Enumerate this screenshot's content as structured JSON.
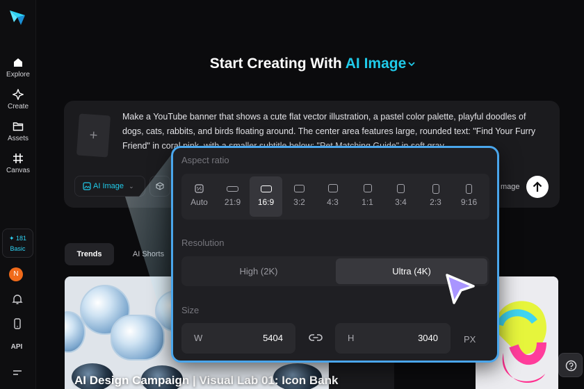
{
  "sidebar": {
    "logo": "app-logo",
    "items": [
      {
        "label": "Explore",
        "icon": "home-icon"
      },
      {
        "label": "Create",
        "icon": "sparkle-icon"
      },
      {
        "label": "Assets",
        "icon": "folder-icon"
      },
      {
        "label": "Canvas",
        "icon": "grid-icon"
      }
    ],
    "credits": "✦ 181",
    "plan": "Basic",
    "avatar_initial": "N",
    "api_label": "API"
  },
  "header": {
    "title_prefix": "Start Creating With",
    "title_accent": "AI Image",
    "accent_color": "#20cbea"
  },
  "prompt": {
    "add_glyph": "+",
    "text": "Make a YouTube banner that shows a cute flat vector illustration, a pastel color palette, playful doodles of dogs, cats, rabbits, and birds floating around. The center area features large, rounded text: \"Find Your Furry Friend\" in coral pink, with a smaller subtitle below: \"Pet Matching Guide\" in soft gray.",
    "mode_label": "AI Image",
    "trailing_label": "mage"
  },
  "tabs": [
    {
      "label": "Trends"
    },
    {
      "label": "AI Shorts"
    }
  ],
  "gallery": {
    "caption": "AI Design Campaign | Visual Lab 01: Icon Bank"
  },
  "popover": {
    "aspect_label": "Aspect ratio",
    "ratios": [
      {
        "label": "Auto",
        "icon": "auto-ratio-icon"
      },
      {
        "label": "21:9",
        "icon": "ratio-21-9-icon"
      },
      {
        "label": "16:9",
        "icon": "ratio-16-9-icon",
        "selected": true
      },
      {
        "label": "3:2",
        "icon": "ratio-3-2-icon"
      },
      {
        "label": "4:3",
        "icon": "ratio-4-3-icon"
      },
      {
        "label": "1:1",
        "icon": "ratio-1-1-icon"
      },
      {
        "label": "3:4",
        "icon": "ratio-3-4-icon"
      },
      {
        "label": "2:3",
        "icon": "ratio-2-3-icon"
      },
      {
        "label": "9:16",
        "icon": "ratio-9-16-icon"
      }
    ],
    "resolution_label": "Resolution",
    "resolutions": [
      {
        "label": "High (2K)"
      },
      {
        "label": "Ultra (4K)",
        "selected": true
      }
    ],
    "size_label": "Size",
    "width_label": "W",
    "width_value": "5404",
    "height_label": "H",
    "height_value": "3040",
    "unit": "PX",
    "border_color": "#4aa6ec"
  }
}
